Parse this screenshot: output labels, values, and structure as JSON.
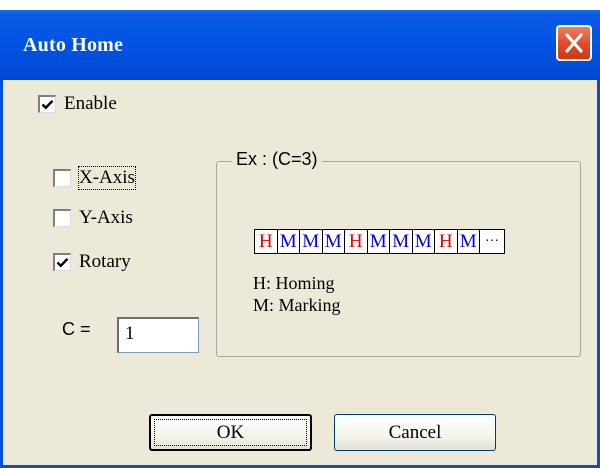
{
  "window": {
    "title": "Auto Home"
  },
  "enable": {
    "label": "Enable",
    "checked": true
  },
  "axes": [
    {
      "label": "X-Axis",
      "checked": false
    },
    {
      "label": "Y-Axis",
      "checked": false
    },
    {
      "label": "Rotary",
      "checked": true
    }
  ],
  "example": {
    "legend": "Ex : (C=3)",
    "sequence": [
      "H",
      "M",
      "M",
      "M",
      "H",
      "M",
      "M",
      "M",
      "H",
      "M",
      "···"
    ],
    "homing_text": "H: Homing",
    "marking_text": "M: Marking",
    "colors": {
      "homing": "#e00000",
      "marking": "#0000e0"
    }
  },
  "count": {
    "label": "C =",
    "value": "1"
  },
  "buttons": {
    "ok": "OK",
    "cancel": "Cancel"
  }
}
